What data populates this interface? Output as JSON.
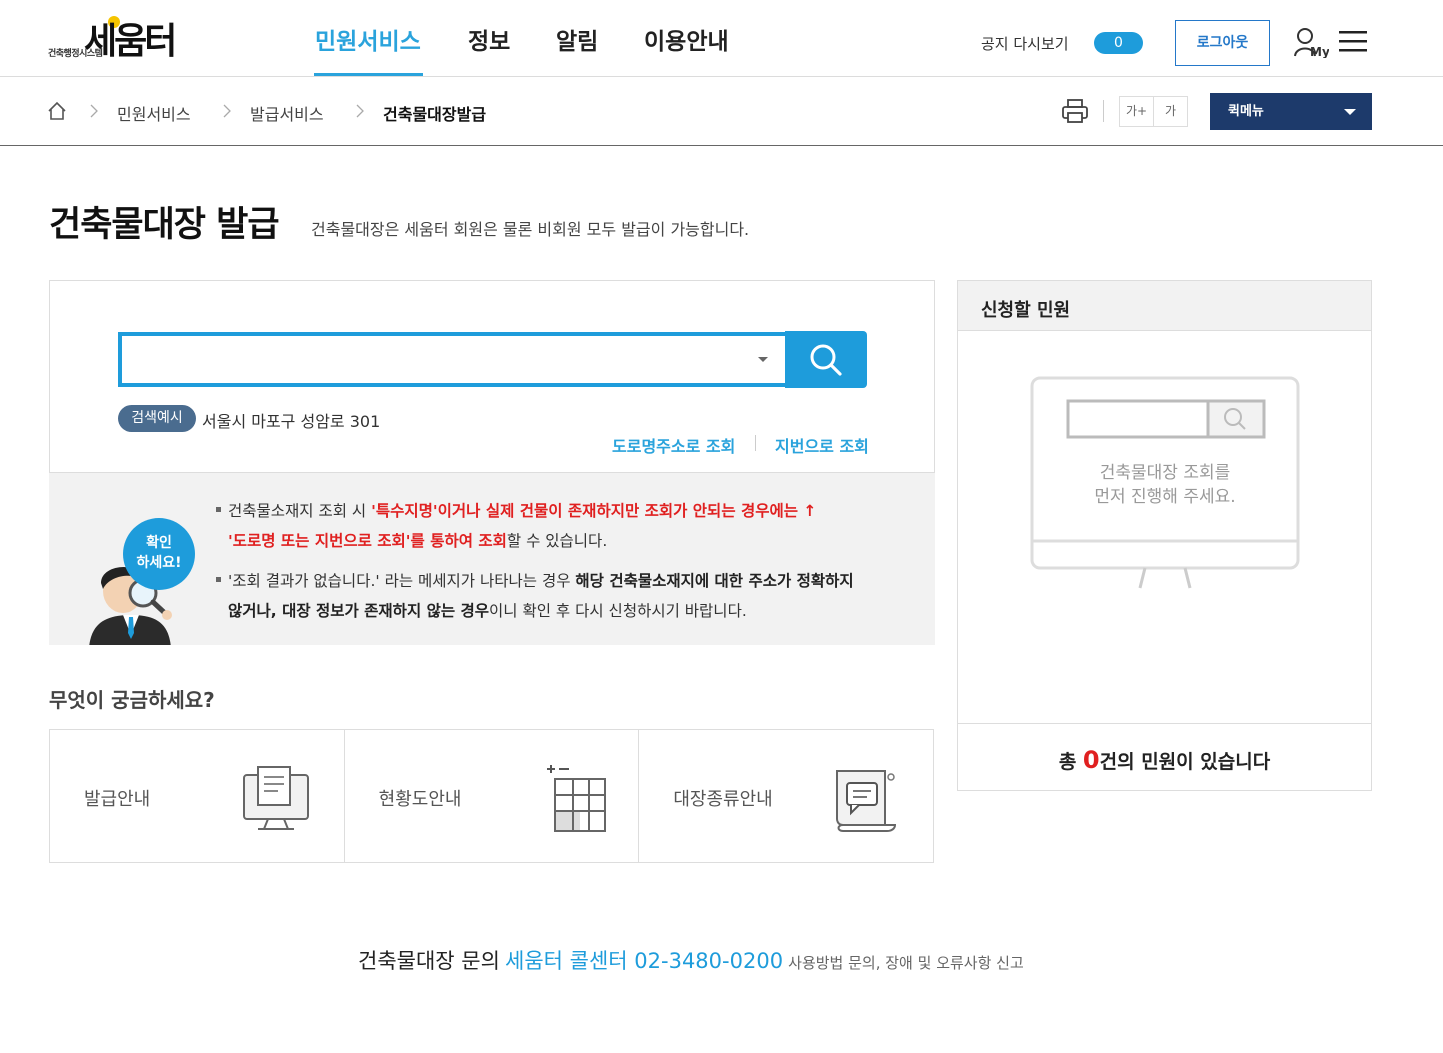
{
  "header": {
    "logo_text": "세움터",
    "logo_sub": "건축행정시스템",
    "nav": [
      "민원서비스",
      "정보",
      "알림",
      "이용안내"
    ],
    "notice_label": "공지 다시보기",
    "notice_count": "0",
    "logout": "로그아웃",
    "my_label": "My"
  },
  "breadcrumb": {
    "items": [
      "민원서비스",
      "발급서비스",
      "건축물대장발급"
    ],
    "font_large": "가+",
    "font_small": "가",
    "quick_menu": "퀵메뉴"
  },
  "page": {
    "title": "건축물대장 발급",
    "description": "건축물대장은 세움터 회원은 물론 비회원 모두 발급이 가능합니다."
  },
  "search": {
    "value": "",
    "example_badge": "검색예시",
    "example_text": "서울시 마포구 성암로 301",
    "link_road": "도로명주소로 조회",
    "link_lot": "지번으로 조회"
  },
  "info": {
    "bubble_line1": "확인",
    "bubble_line2": "하세요!",
    "line1_a": "건축물소재지 조회 시 ",
    "line1_b": "'특수지명'이거나 실제 건물이 존재하지만 조회가 안되는 경우에는 ↑",
    "line2_a": "'도로명 또는 지번으로 조회'를 통하여 조회",
    "line2_b": "할 수 있습니다.",
    "line3_a": "'조회 결과가 없습니다.' 라는 메세지가 나타나는 경우 ",
    "line3_b": "해당 건축물소재지에 대한 주소가 정확하지",
    "line4_a": "않거나, 대장 정보가 존재하지 않는 경우",
    "line4_b": "이니 확인 후 다시 신청하시기 바랍니다."
  },
  "faq": {
    "title": "무엇이 궁금하세요?",
    "items": [
      {
        "label": "발급안내",
        "icon": "monitor-document-icon"
      },
      {
        "label": "현황도안내",
        "icon": "floor-plan-grid-icon"
      },
      {
        "label": "대장종류안내",
        "icon": "document-speech-icon"
      }
    ]
  },
  "side": {
    "title": "신청할 민원",
    "placeholder_line1": "건축물대장 조회를",
    "placeholder_line2": "먼저 진행해 주세요.",
    "total_prefix": "총 ",
    "total_count": "0",
    "total_suffix": "건의 민원이 있습니다"
  },
  "footer": {
    "label": "건축물대장 문의",
    "contact": "세움터 콜센터 02-3480-0200",
    "note": "사용방법 문의, 장애 및 오류사항 신고"
  },
  "colors": {
    "accent": "#1e9cdb",
    "nav_dark": "#1d3a6b",
    "alert_red": "#e02020"
  }
}
